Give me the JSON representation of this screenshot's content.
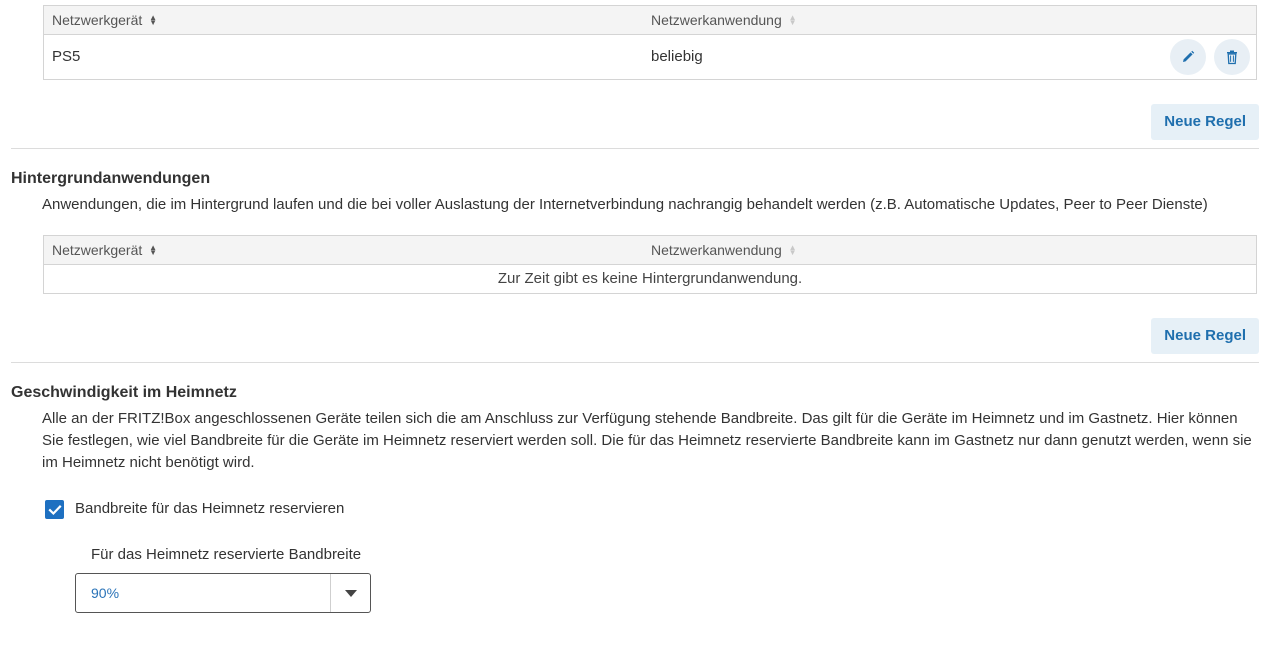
{
  "priority_section": {
    "table": {
      "col_device": "Netzwerkgerät",
      "col_app": "Netzwerkanwendung",
      "rows": [
        {
          "device": "PS5",
          "app": "beliebig"
        }
      ]
    },
    "new_rule_label": "Neue Regel"
  },
  "background_section": {
    "title": "Hintergrundanwendungen",
    "description": "Anwendungen, die im Hintergrund laufen und die bei voller Auslastung der Internetverbindung nachrangig behandelt werden (z.B. Automatische Updates, Peer to Peer Dienste)",
    "table": {
      "col_device": "Netzwerkgerät",
      "col_app": "Netzwerkanwendung",
      "empty_text": "Zur Zeit gibt es keine Hintergrundanwendung."
    },
    "new_rule_label": "Neue Regel"
  },
  "home_network_section": {
    "title": "Geschwindigkeit im Heimnetz",
    "description": "Alle an der FRITZ!Box angeschlossenen Geräte teilen sich die am Anschluss zur Verfügung stehende Bandbreite. Das gilt für die Geräte im Heimnetz und im Gastnetz. Hier können Sie festlegen, wie viel Bandbreite für die Geräte im Heimnetz reserviert werden soll. Die für das Heimnetz reservierte Bandbreite kann im Gastnetz nur dann genutzt werden, wenn sie im Heimnetz nicht benötigt wird.",
    "checkbox_label": "Bandbreite für das Heimnetz reservieren",
    "checkbox_checked": true,
    "select_label": "Für das Heimnetz reservierte Bandbreite",
    "select_value": "90%"
  },
  "colors": {
    "accent": "#1e70c1",
    "button_bg": "#e6f0f7",
    "button_text": "#1f6fae"
  }
}
